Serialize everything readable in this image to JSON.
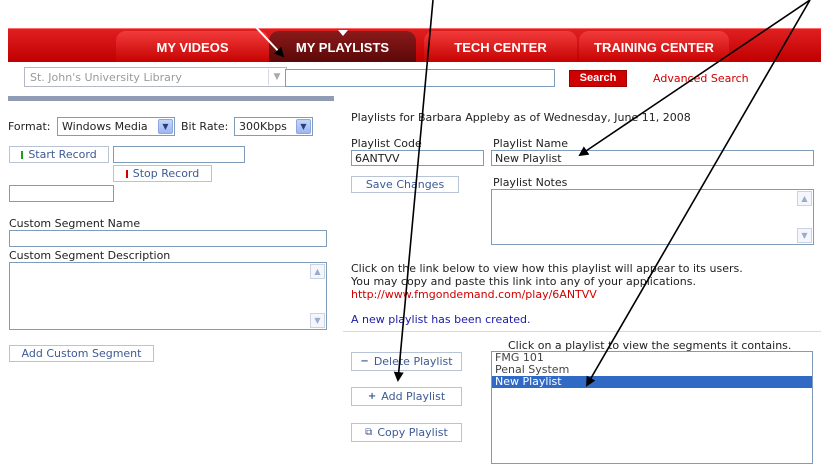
{
  "nav": {
    "tabs": [
      {
        "label": "MY VIDEOS"
      },
      {
        "label": "MY PLAYLISTS"
      },
      {
        "label": "TECH CENTER"
      },
      {
        "label": "TRAINING CENTER"
      }
    ]
  },
  "search": {
    "library_value": "St. John's University Library",
    "query_value": "",
    "button_label": "Search",
    "advanced_label": "Advanced Search"
  },
  "left": {
    "format_label": "Format:",
    "format_value": "Windows Media",
    "bitrate_label": "Bit Rate:",
    "bitrate_value": "300Kbps",
    "start_record_label": "Start Record",
    "start_record_value": "",
    "stop_record_label": "Stop Record",
    "stop_record_value": "",
    "segment_name_label": "Custom Segment Name",
    "segment_name_value": "",
    "segment_desc_label": "Custom Segment Description",
    "segment_desc_value": "",
    "add_segment_label": "Add Custom Segment"
  },
  "right": {
    "heading": "Playlists for Barbara Appleby as of Wednesday, June 11, 2008",
    "code_label": "Playlist Code",
    "code_value": "6ANTVV",
    "name_label": "Playlist Name",
    "name_value": "New Playlist",
    "save_label": "Save Changes",
    "notes_label": "Playlist Notes",
    "notes_value": "",
    "info_line1": "Click on the link below to view how this playlist will appear to its users.",
    "info_line2": "You may copy and paste this link into any of your applications.",
    "link_url": "http://www.fmgondemand.com/play/6ANTVV",
    "created_msg": "A new playlist has been created.",
    "list_hint": "Click on a playlist to view the segments it contains.",
    "delete_label": "Delete Playlist",
    "add_label": "Add Playlist",
    "copy_label": "Copy Playlist",
    "playlists": [
      "FMG 101",
      "Penal System",
      "New Playlist"
    ],
    "selected_playlist": "New Playlist"
  },
  "colors": {
    "nav_red": "#d00000",
    "nav_active": "#6e1010",
    "list_selected": "#316ac5",
    "link_red": "#d00000",
    "msg_blue": "#1a1aa8"
  },
  "icons": {
    "start": "green-bar-icon",
    "stop": "red-bar-icon",
    "delete": "minus-icon",
    "add": "plus-icon",
    "copy": "copy-icon",
    "dropdown": "chevron-down-icon"
  }
}
